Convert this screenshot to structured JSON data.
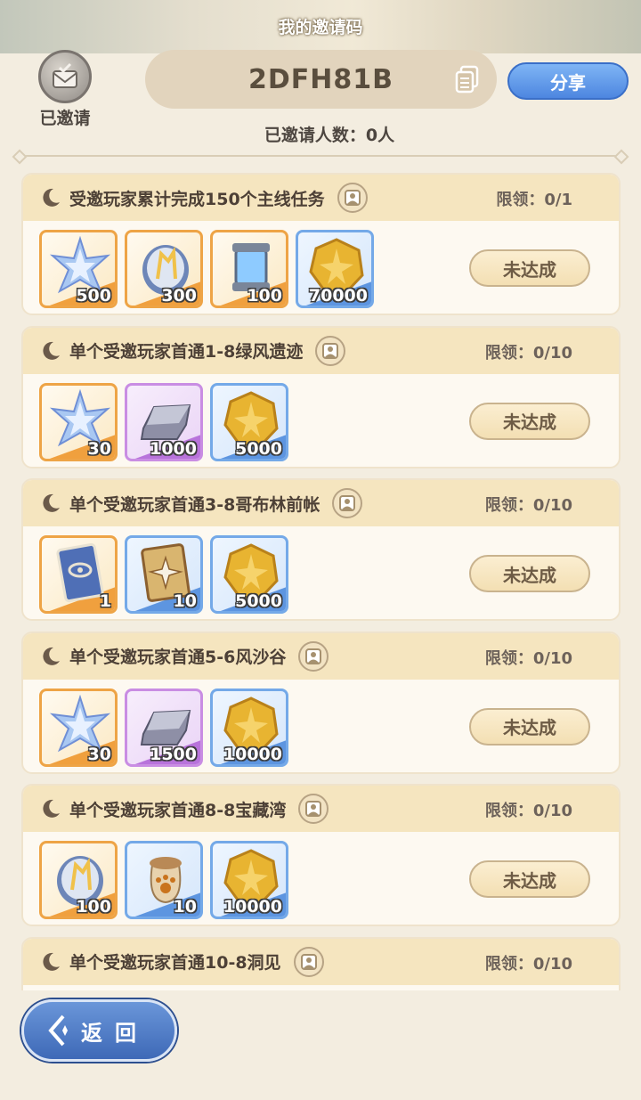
{
  "header": {
    "title": "我的邀请码",
    "invited_label": "已邀请",
    "invite_code": "2DFH81B",
    "share_label": "分享",
    "invite_count_text": "已邀请人数：0人"
  },
  "tasks": [
    {
      "title": "受邀玩家累计完成150个主线任务",
      "limit": "限领：0/1",
      "status": "未达成",
      "rewards": [
        {
          "icon": "star-crystal-icon",
          "qty": "500",
          "tier": "orange"
        },
        {
          "icon": "orb-icon",
          "qty": "300",
          "tier": "orange"
        },
        {
          "icon": "capsule-icon",
          "qty": "100",
          "tier": "orange"
        },
        {
          "icon": "gold-coin-icon",
          "qty": "70000",
          "tier": "blue"
        }
      ]
    },
    {
      "title": "单个受邀玩家首通1-8绿风遗迹",
      "limit": "限领：0/10",
      "status": "未达成",
      "rewards": [
        {
          "icon": "star-crystal-icon",
          "qty": "30",
          "tier": "orange"
        },
        {
          "icon": "ingot-icon",
          "qty": "1000",
          "tier": "purple"
        },
        {
          "icon": "gold-coin-icon",
          "qty": "5000",
          "tier": "blue"
        }
      ]
    },
    {
      "title": "单个受邀玩家首通3-8哥布林前帐",
      "limit": "限领：0/10",
      "status": "未达成",
      "rewards": [
        {
          "icon": "eye-card-icon",
          "qty": "1",
          "tier": "orange"
        },
        {
          "icon": "star-card-icon",
          "qty": "10",
          "tier": "blue"
        },
        {
          "icon": "gold-coin-icon",
          "qty": "5000",
          "tier": "blue"
        }
      ]
    },
    {
      "title": "单个受邀玩家首通5-6风沙谷",
      "limit": "限领：0/10",
      "status": "未达成",
      "rewards": [
        {
          "icon": "star-crystal-icon",
          "qty": "30",
          "tier": "orange"
        },
        {
          "icon": "ingot-icon",
          "qty": "1500",
          "tier": "purple"
        },
        {
          "icon": "gold-coin-icon",
          "qty": "10000",
          "tier": "blue"
        }
      ]
    },
    {
      "title": "单个受邀玩家首通8-8宝藏湾",
      "limit": "限领：0/10",
      "status": "未达成",
      "rewards": [
        {
          "icon": "orb-icon",
          "qty": "100",
          "tier": "orange"
        },
        {
          "icon": "paw-bag-icon",
          "qty": "10",
          "tier": "blue"
        },
        {
          "icon": "gold-coin-icon",
          "qty": "10000",
          "tier": "blue"
        }
      ]
    },
    {
      "title": "单个受邀玩家首通10-8洞见",
      "limit": "限领：0/10",
      "status": "",
      "rewards": []
    }
  ],
  "footer": {
    "back_label": "返回"
  }
}
